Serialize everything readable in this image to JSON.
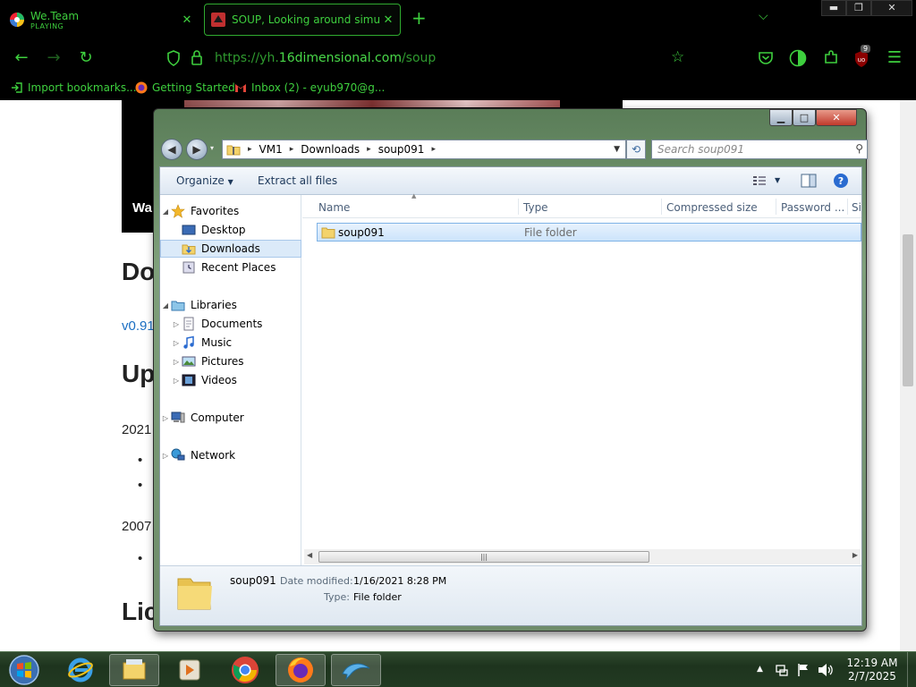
{
  "browser": {
    "tabs": [
      {
        "title": "We.Team",
        "subtitle": "PLAYING"
      },
      {
        "title": "SOUP, Looking around simulat..."
      }
    ],
    "url_prefix": "https://yh.",
    "url_domain": "16dimensional.com",
    "url_path": "/soup",
    "extension_badge": "9",
    "bookmarks": [
      "Import bookmarks...",
      "Getting Started",
      "Inbox (2) - eyub970@g..."
    ]
  },
  "page_behind": {
    "fragments": [
      "Wa",
      "Do",
      "v0.91",
      "Up",
      "2021",
      "2007",
      "Lic"
    ]
  },
  "explorer": {
    "breadcrumbs": [
      "VM1",
      "Downloads",
      "soup091"
    ],
    "search_placeholder": "Search soup091",
    "toolbar": {
      "organize": "Organize",
      "extract": "Extract all files"
    },
    "nav": {
      "favorites": "Favorites",
      "desktop": "Desktop",
      "downloads": "Downloads",
      "recent": "Recent Places",
      "libraries": "Libraries",
      "documents": "Documents",
      "music": "Music",
      "pictures": "Pictures",
      "videos": "Videos",
      "computer": "Computer",
      "network": "Network"
    },
    "columns": [
      "Name",
      "Type",
      "Compressed size",
      "Password ...",
      "Si"
    ],
    "files": [
      {
        "name": "soup091",
        "type": "File folder"
      }
    ],
    "details": {
      "name": "soup091",
      "modified_label": "Date modified:",
      "modified_value": "1/16/2021 8:28 PM",
      "type_label": "Type:",
      "type_value": "File folder"
    }
  },
  "taskbar": {
    "time": "12:19 AM",
    "date": "2/7/2025"
  }
}
